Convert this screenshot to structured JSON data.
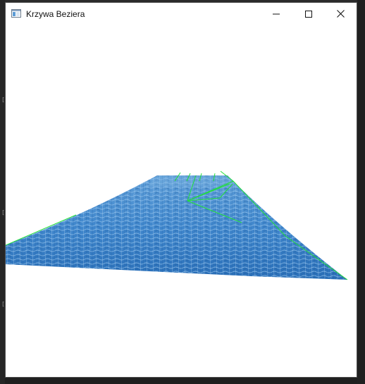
{
  "window": {
    "title": "Krzywa Beziera",
    "icon": "app-window-icon",
    "controls": {
      "minimize_icon": "minimize-icon",
      "maximize_icon": "maximize-icon",
      "close_icon": "close-icon"
    }
  },
  "scene": {
    "surface_texture": "water-texture",
    "surface_color": "#3b7fc4",
    "control_line_color": "#00ff00",
    "background_color": "#ffffff"
  }
}
